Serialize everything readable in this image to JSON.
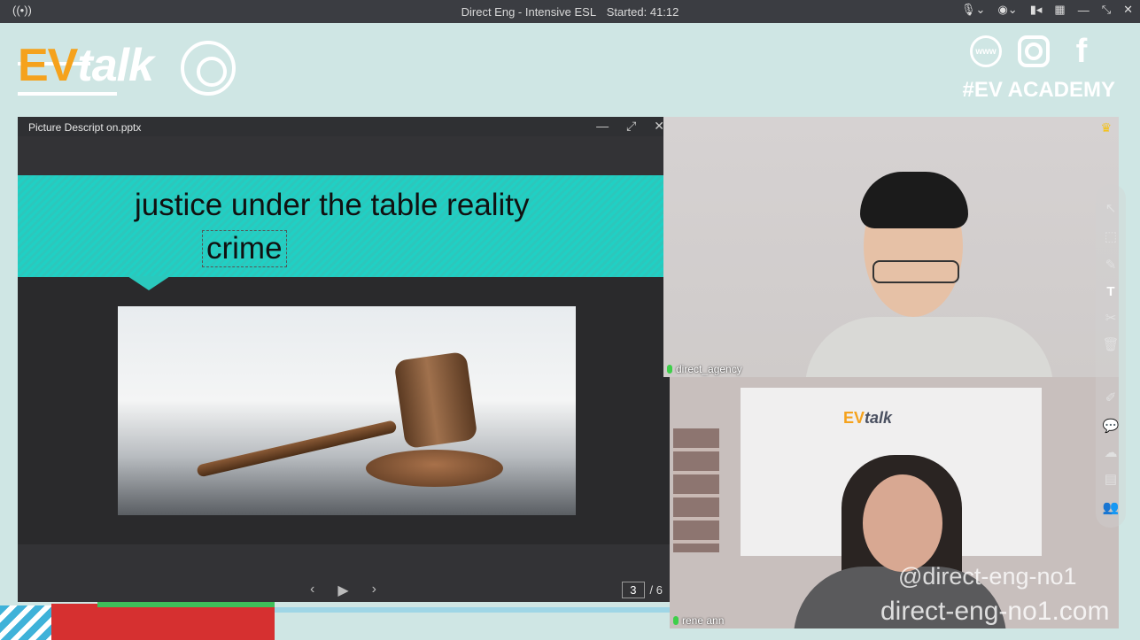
{
  "window": {
    "broadcast_icon": "broadcast-icon",
    "title": "Direct Eng - Intensive ESL",
    "started_label": "Started: 41:12"
  },
  "banner": {
    "logo_ev": "EV",
    "logo_talk": "talk",
    "social": {
      "www": "www",
      "facebook": "f"
    },
    "hashtag": "#EV ACADEMY"
  },
  "viewer": {
    "file_name": "Picture Descript on.pptx",
    "slide_title": "justice under the table reality",
    "slide_word": "crime",
    "page_current": "3",
    "page_total": "/ 6"
  },
  "videos": {
    "teacher_name": "direct_agency",
    "student_name": "rene ann",
    "wall_logo_ev": "EV",
    "wall_logo_talk": "talk"
  },
  "watermark": {
    "handle": "@direct-eng-no1",
    "site": "direct-eng-no1.com"
  },
  "icons": {
    "mic": "microphone-icon",
    "camera": "camera-icon",
    "grid": "grid-icon",
    "minimize": "minimize-icon",
    "expand": "expand-icon",
    "close": "close-icon",
    "crown": "crown-icon"
  },
  "colors": {
    "accent_orange": "#f5a21c",
    "teal": "#20d0c4",
    "banner_bg": "#cfe6e4"
  }
}
